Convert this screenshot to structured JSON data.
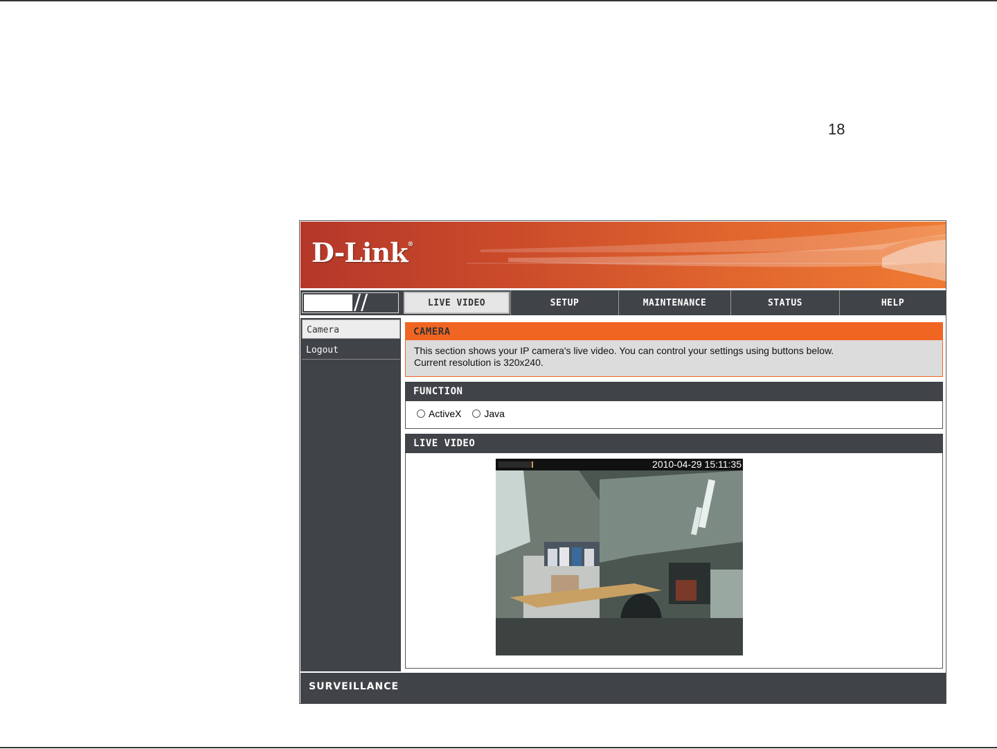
{
  "page": {
    "page_number": "18"
  },
  "header": {
    "logo_text": "D-Link",
    "logo_mark": "®"
  },
  "nav": {
    "tabs": [
      {
        "label": "LIVE VIDEO",
        "active": true
      },
      {
        "label": "SETUP",
        "active": false
      },
      {
        "label": "MAINTENANCE",
        "active": false
      },
      {
        "label": "STATUS",
        "active": false
      },
      {
        "label": "HELP",
        "active": false
      }
    ]
  },
  "sidebar": {
    "items": [
      {
        "label": "Camera",
        "active": true
      },
      {
        "label": "Logout",
        "active": false
      }
    ]
  },
  "camera_section": {
    "title": "CAMERA",
    "line1": "This section shows your IP camera's live video. You can control your settings using buttons below.",
    "line2": "Current resolution is 320x240."
  },
  "function_section": {
    "title": "FUNCTION",
    "options": [
      {
        "label": "ActiveX",
        "selected": false
      },
      {
        "label": "Java",
        "selected": false
      }
    ]
  },
  "live_video_section": {
    "title": "LIVE VIDEO",
    "timestamp": "2010-04-29 15:11:35"
  },
  "footer": {
    "label": "SURVEILLANCE"
  },
  "colors": {
    "brand_orange": "#f16522",
    "nav_dark": "#404347",
    "banner_red": "#b5372a"
  }
}
